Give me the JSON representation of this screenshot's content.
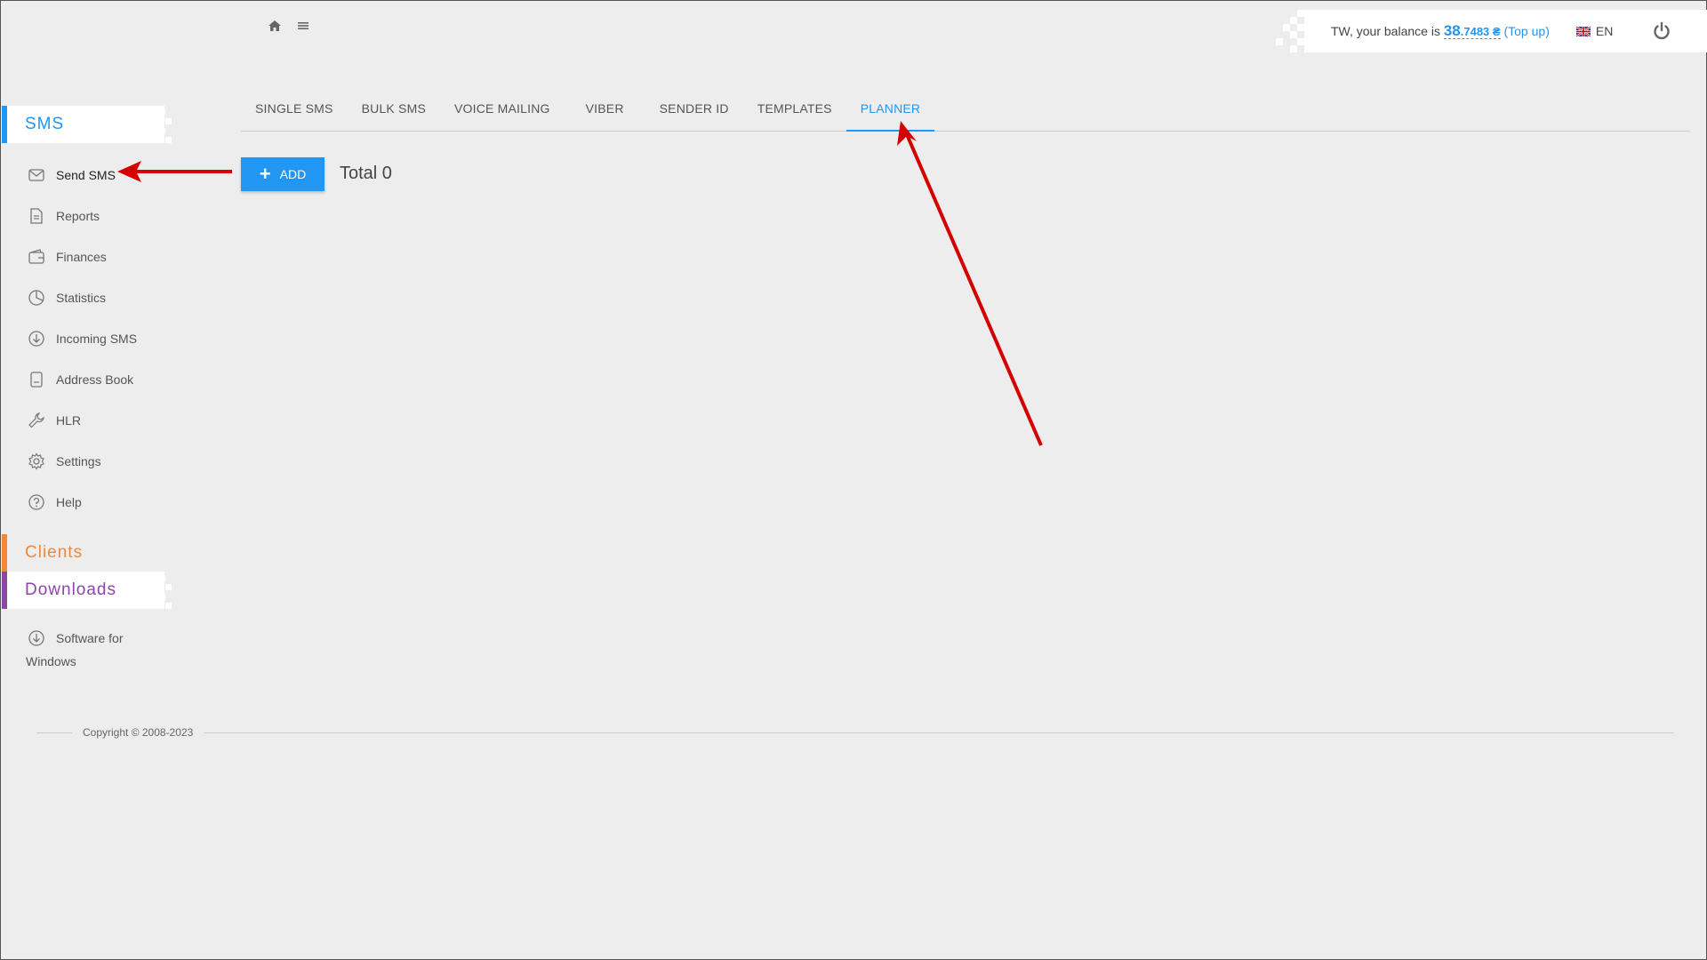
{
  "header": {
    "balance_prefix": "TW, your balance is ",
    "balance_main": "38",
    "balance_fraction": ".7483 ₴",
    "topup_open": " (",
    "topup_label": "Top up",
    "topup_close": ")",
    "language": "EN"
  },
  "sidebar": {
    "sections": {
      "sms": "SMS",
      "clients": "Clients",
      "downloads": "Downloads"
    },
    "items": [
      {
        "label": "Send SMS",
        "icon": "envelope-icon"
      },
      {
        "label": "Reports",
        "icon": "document-icon"
      },
      {
        "label": "Finances",
        "icon": "wallet-icon"
      },
      {
        "label": "Statistics",
        "icon": "pie-chart-icon"
      },
      {
        "label": "Incoming SMS",
        "icon": "download-circle-icon"
      },
      {
        "label": "Address Book",
        "icon": "book-icon"
      },
      {
        "label": "HLR",
        "icon": "wrench-icon"
      },
      {
        "label": "Settings",
        "icon": "gear-icon"
      },
      {
        "label": "Help",
        "icon": "help-icon"
      }
    ],
    "downloads_item_line1": "Software for",
    "downloads_item_line2": "Windows"
  },
  "tabs": [
    "SINGLE SMS",
    "BULK SMS",
    "VOICE MAILING",
    "VIBER",
    "SENDER ID",
    "TEMPLATES",
    "PLANNER"
  ],
  "active_tab": "PLANNER",
  "main": {
    "add_label": "ADD",
    "total_label": "Total 0"
  },
  "footer": {
    "copyright": "Copyright © 2008-2023"
  },
  "colors": {
    "accent": "#2196f3",
    "clients": "#f0883a",
    "downloads": "#8e44ad",
    "annotation_arrow": "#d40000"
  }
}
